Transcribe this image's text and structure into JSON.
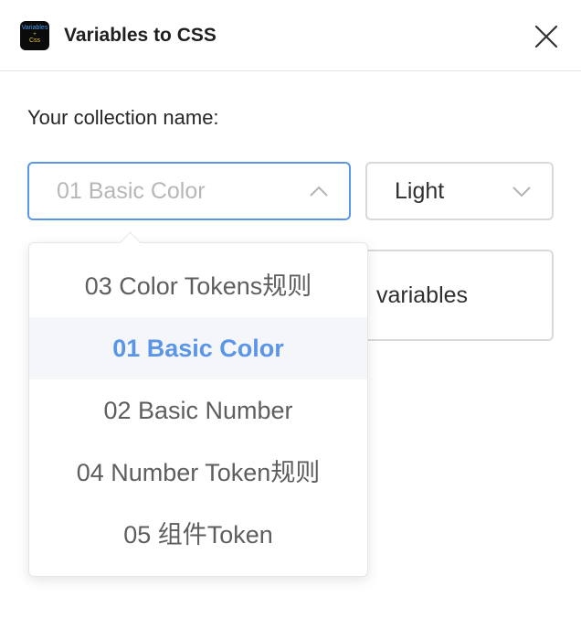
{
  "app": {
    "title": "Variables to CSS",
    "icon": {
      "name": "variables-to-css-app-icon",
      "line1": "Variables",
      "line2": "+",
      "line3": "Css",
      "colors": {
        "background": "#0b0b0b",
        "text_blue": "#4a9af0",
        "text_yellow": "#e6c23c"
      }
    }
  },
  "form": {
    "label": "Your collection name:",
    "collection_select": {
      "value": "01 Basic Color",
      "icon": "chevron-up-icon"
    },
    "mode_select": {
      "value": "Light",
      "icon": "chevron-down-icon"
    },
    "action_button": {
      "label": "variables"
    }
  },
  "dropdown": {
    "options": [
      {
        "label": "03 Color Tokens规则",
        "selected": false
      },
      {
        "label": "01 Basic Color",
        "selected": true
      },
      {
        "label": "02 Basic Number",
        "selected": false
      },
      {
        "label": "04 Number Token规则",
        "selected": false
      },
      {
        "label": "05 组件Token",
        "selected": false
      }
    ]
  },
  "colors": {
    "accent": "#5b95e8",
    "border": "#d9d9d9",
    "selected_bg": "#f4f6f9",
    "text": "#262626",
    "muted_text": "#b7b7b7"
  }
}
